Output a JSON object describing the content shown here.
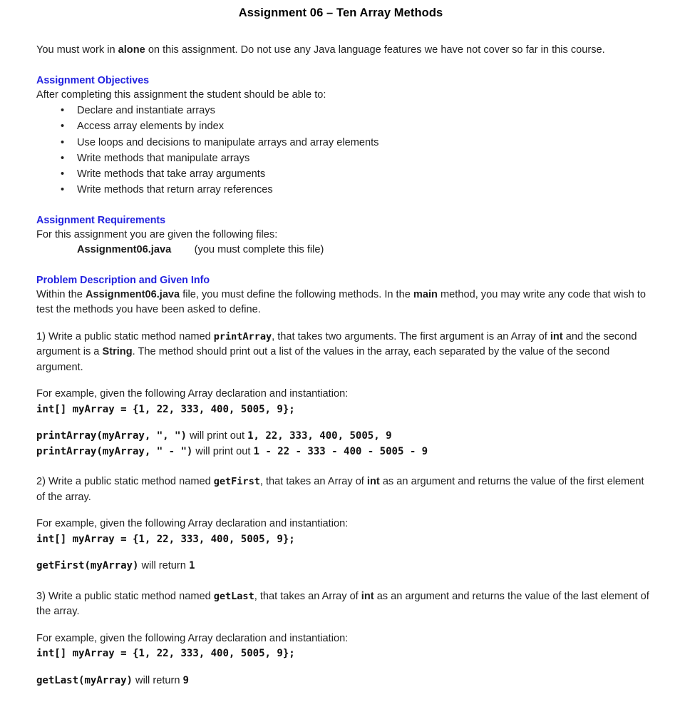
{
  "document": {
    "title": "Assignment 06 – Ten Array Methods",
    "intro": {
      "before": "You must work in ",
      "emphasis": "alone",
      "after": " on this assignment. Do not use any Java language features we have not cover so far in this course."
    },
    "sections": [
      {
        "heading": "Assignment Objectives",
        "lead": "After completing this assignment the student should be able to:",
        "bullets": [
          "Declare and instantiate arrays",
          "Access array elements by index",
          "Use loops and decisions to manipulate arrays and array elements",
          "Write methods that manipulate arrays",
          "Write methods that take array arguments",
          "Write methods that return array references"
        ],
        "bullet_glyph": "•"
      },
      {
        "heading": "Assignment Requirements",
        "lead": "For this assignment you are given the following files:",
        "file_name": "Assignment06.java",
        "file_note": "(you must complete this file)"
      },
      {
        "heading": "Problem Description and Given Info",
        "intro_1a": "Within the ",
        "intro_1b": "Assignment06.java",
        "intro_1c": " file, you must define the following methods. In the ",
        "intro_1d": "main",
        "intro_1e": " method, you may write any code that wish to test the methods you have been asked to define."
      }
    ],
    "problems": [
      {
        "number": "1)",
        "text_a": " Write a public static method named ",
        "method": "printArray",
        "text_b": ", that takes two arguments. The first argument is an Array of ",
        "type_1": "int",
        "text_c": " and the second argument is a ",
        "type_2": "String",
        "text_d": ". The method should print out a list of the values in the array, each separated by the value of the second argument.",
        "example_lead": "For example, given the following Array declaration and instantiation:",
        "declaration": "int[] myArray = {1, 22, 333, 400, 5005, 9};",
        "results": [
          {
            "call": "printArray(myArray, \", \")",
            "connector": " will print out ",
            "output": "1, 22, 333, 400, 5005, 9"
          },
          {
            "call": "printArray(myArray, \" - \")",
            "connector": " will print out ",
            "output": "1 - 22 - 333 - 400 - 5005 - 9"
          }
        ]
      },
      {
        "number": "2)",
        "text_a": " Write a public static method named ",
        "method": "getFirst",
        "text_b": ", that takes an Array of ",
        "type_1": "int",
        "text_c": " as an argument and returns the value of the first element of the array.",
        "example_lead": "For example, given the following Array declaration and instantiation:",
        "declaration": "int[] myArray = {1, 22, 333, 400, 5005, 9};",
        "results": [
          {
            "call": "getFirst(myArray)",
            "connector": " will return ",
            "output": "1"
          }
        ]
      },
      {
        "number": "3)",
        "text_a": " Write a public static method named ",
        "method": "getLast",
        "text_b": ", that takes an Array of ",
        "type_1": "int",
        "text_c": " as an argument and returns the value of the last element of the array.",
        "example_lead": "For example, given the following Array declaration and instantiation:",
        "declaration": "int[] myArray = {1, 22, 333, 400, 5005, 9};",
        "results": [
          {
            "call": "getLast(myArray)",
            "connector": " will return ",
            "output": "9"
          }
        ]
      }
    ],
    "colors": {
      "heading": "#2222e0",
      "body": "#1f1f1f",
      "code": "#111111"
    }
  }
}
